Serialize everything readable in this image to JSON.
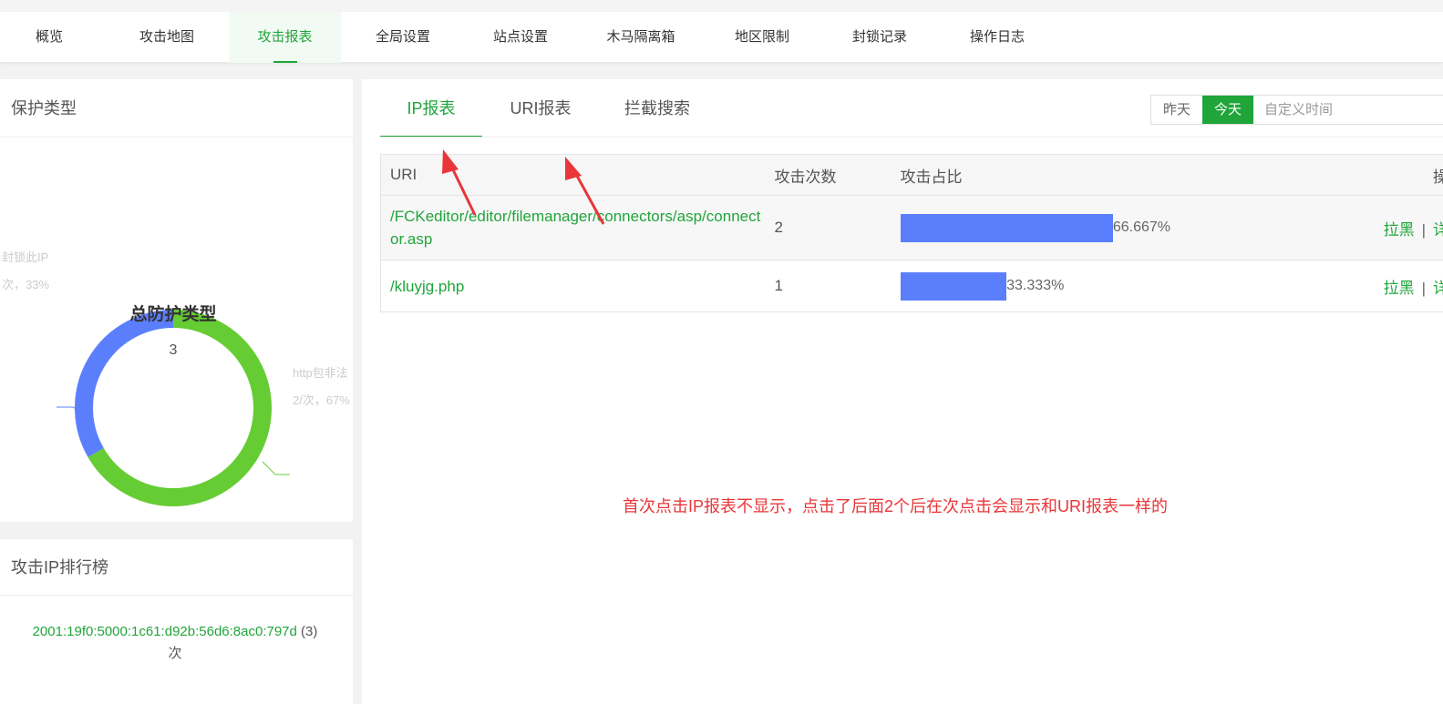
{
  "topnav": {
    "items": [
      {
        "label": "概览"
      },
      {
        "label": "攻击地图"
      },
      {
        "label": "攻击报表",
        "active": true
      },
      {
        "label": "全局设置"
      },
      {
        "label": "站点设置"
      },
      {
        "label": "木马隔离箱"
      },
      {
        "label": "地区限制"
      },
      {
        "label": "封锁记录"
      },
      {
        "label": "操作日志"
      }
    ]
  },
  "protection": {
    "title": "保护类型",
    "center_title": "总防护类型",
    "total": "3",
    "segments": [
      {
        "label": "封锁此IP",
        "detail": "次，33%",
        "value": 1,
        "percent": 33,
        "color": "#5b7ffc"
      },
      {
        "label": "http包非法",
        "detail": "2/次，67%",
        "value": 2,
        "percent": 67,
        "color": "#66cc33"
      }
    ]
  },
  "ip_rank": {
    "title": "攻击IP排行榜",
    "items": [
      {
        "ip": "2001:19f0:5000:1c61:d92b:56d6:8ac0:797d",
        "count": "(3)",
        "unit": "次"
      }
    ]
  },
  "report": {
    "tabs": [
      {
        "label": "IP报表",
        "active": true
      },
      {
        "label": "URI报表"
      },
      {
        "label": "拦截搜索"
      }
    ],
    "date": {
      "yesterday": "昨天",
      "today": "今天",
      "custom_placeholder": "自定义时间"
    },
    "columns": {
      "uri": "URI",
      "count": "攻击次数",
      "ratio": "攻击占比",
      "op": "操作"
    },
    "rows": [
      {
        "uri": "/FCKeditor/editor/filemanager/connectors/asp/connector.asp",
        "count": "2",
        "ratio": 66.667,
        "ratio_text": "66.667%",
        "blacklist": "拉黑",
        "sep": "|",
        "detail": "详情"
      },
      {
        "uri": "/kluyjg.php",
        "count": "1",
        "ratio": 33.333,
        "ratio_text": "33.333%",
        "blacklist": "拉黑",
        "sep": "|",
        "detail": "详情"
      }
    ]
  },
  "annotation": {
    "text": "首次点击IP报表不显示，点击了后面2个后在次点击会显示和URI报表一样的",
    "color": "#e8363a"
  },
  "colors": {
    "accent": "#20a53a",
    "bar": "#5b7ffc",
    "donut_green": "#66cc33"
  }
}
